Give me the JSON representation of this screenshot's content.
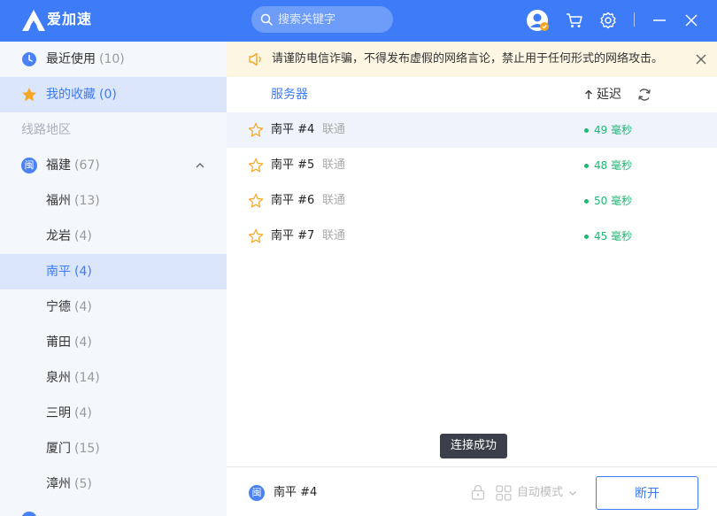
{
  "app": {
    "title": "爱加速"
  },
  "search": {
    "placeholder": "搜索关键字"
  },
  "sidebar": {
    "recent": {
      "label": "最近使用",
      "count": "(10)"
    },
    "favorites": {
      "label": "我的收藏",
      "count": "(0)"
    },
    "section_label": "线路地区",
    "province": {
      "label": "福建",
      "count": "(67)",
      "badge": "闽"
    },
    "cities": [
      {
        "label": "福州",
        "count": "(13)"
      },
      {
        "label": "龙岩",
        "count": "(4)"
      },
      {
        "label": "南平",
        "count": "(4)"
      },
      {
        "label": "宁德",
        "count": "(4)"
      },
      {
        "label": "莆田",
        "count": "(4)"
      },
      {
        "label": "泉州",
        "count": "(14)"
      },
      {
        "label": "三明",
        "count": "(4)"
      },
      {
        "label": "厦门",
        "count": "(15)"
      },
      {
        "label": "漳州",
        "count": "(5)"
      }
    ]
  },
  "notice": {
    "text": "请谨防电信诈骗，不得发布虚假的网络言论，禁止用于任何形式的网络攻击。"
  },
  "list": {
    "header_server": "服务器",
    "header_latency": "延迟",
    "rows": [
      {
        "name": "南平 #4",
        "isp": "联通",
        "latency": "49 毫秒"
      },
      {
        "name": "南平 #5",
        "isp": "联通",
        "latency": "48 毫秒"
      },
      {
        "name": "南平 #6",
        "isp": "联通",
        "latency": "50 毫秒"
      },
      {
        "name": "南平 #7",
        "isp": "联通",
        "latency": "45 毫秒"
      }
    ]
  },
  "toast": {
    "text": "连接成功"
  },
  "footer": {
    "badge": "闽",
    "current_server": "南平 #4",
    "mode": "自动模式",
    "disconnect_label": "断开"
  },
  "colors": {
    "accent": "#3d7bf7",
    "latency_ok": "#22b573",
    "notice_bg": "#fdf6e3"
  }
}
